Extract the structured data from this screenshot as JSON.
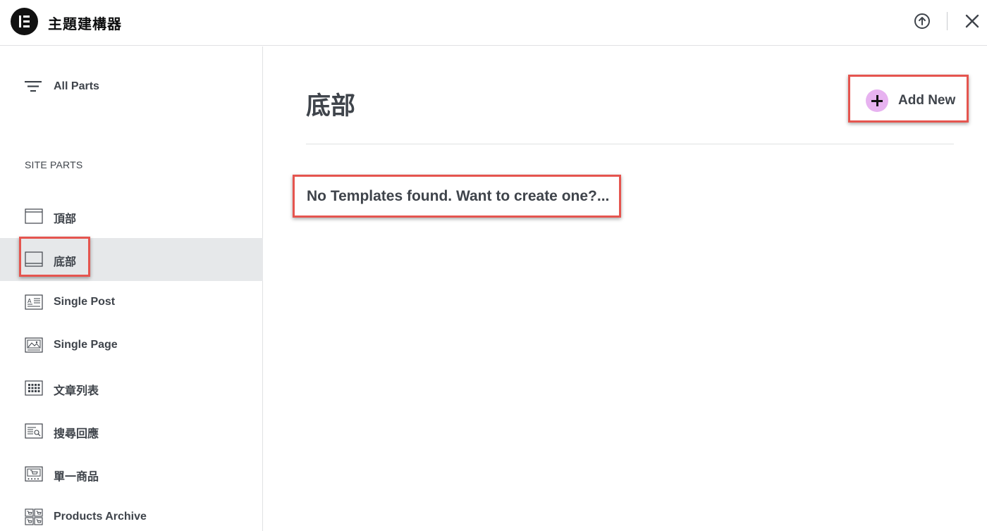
{
  "header": {
    "title": "主題建構器",
    "logo_icon": "elementor-logo-icon",
    "upload_icon": "upload-circle-icon",
    "close_icon": "close-icon"
  },
  "sidebar": {
    "all_parts_label": "All Parts",
    "section_title": "SITE PARTS",
    "items": [
      {
        "label": "頂部",
        "icon": "header-layout-icon",
        "active": false
      },
      {
        "label": "底部",
        "icon": "footer-layout-icon",
        "active": true
      },
      {
        "label": "Single Post",
        "icon": "single-post-icon",
        "active": false
      },
      {
        "label": "Single Page",
        "icon": "single-page-icon",
        "active": false
      },
      {
        "label": "文章列表",
        "icon": "archive-grid-icon",
        "active": false
      },
      {
        "label": "搜尋回應",
        "icon": "search-results-icon",
        "active": false
      },
      {
        "label": "單一商品",
        "icon": "single-product-icon",
        "active": false
      },
      {
        "label": "Products Archive",
        "icon": "products-archive-icon",
        "active": false
      }
    ]
  },
  "main": {
    "title": "底部",
    "add_new_label": "Add New",
    "empty_message": "No Templates found. Want to create one?..."
  },
  "colors": {
    "accent_plus": "#e7b2f0",
    "active_bg": "#e6e8ea",
    "highlight_box": "#e5554f",
    "text": "#3f444b"
  }
}
